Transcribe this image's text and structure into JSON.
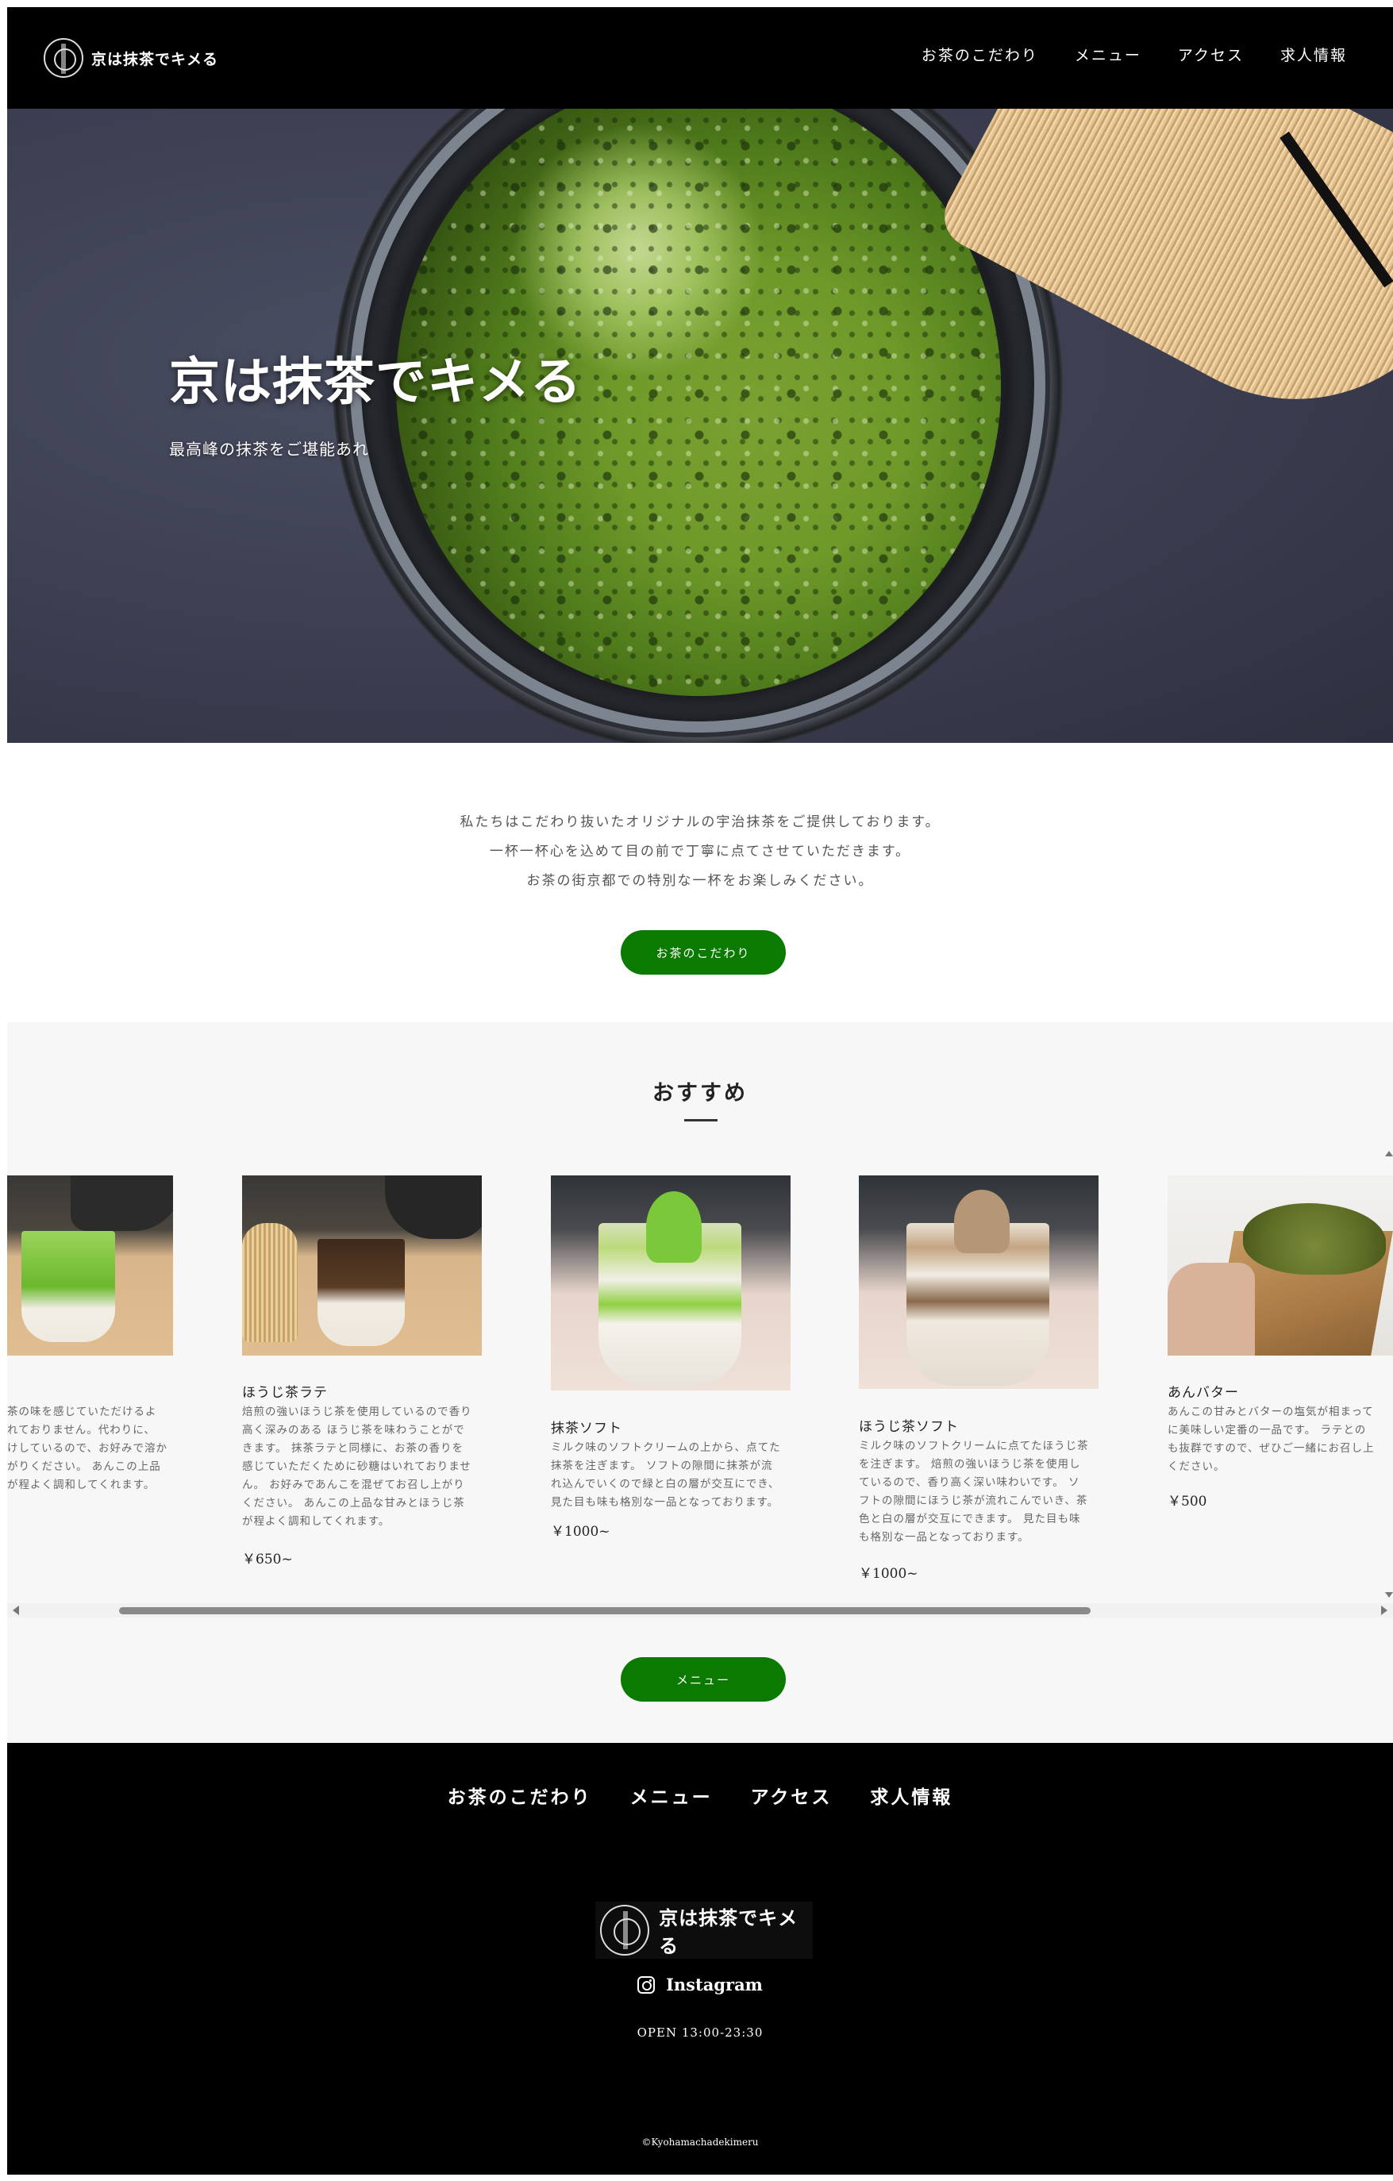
{
  "header": {
    "logo_text": "京は抹茶でキメる",
    "nav": [
      "お茶のこだわり",
      "メニュー",
      "アクセス",
      "求人情報"
    ]
  },
  "hero": {
    "title": "京は抹茶でキメる",
    "subtitle": "最高峰の抹茶をご堪能あれ"
  },
  "intro": {
    "lines": [
      "私たちはこだわり抜いたオリジナルの宇治抹茶をご提供しております。",
      "一杯一杯心を込めて目の前で丁寧に点てさせていただきます。",
      "お茶の街京都での特別な一杯をお楽しみください。"
    ],
    "button": "お茶のこだわり"
  },
  "recommend": {
    "title": "おすすめ",
    "items": [
      {
        "name": "",
        "desc": "茶の味を感じていただけるよ\nれておりません。代わりに、\nけしているので、お好みで溶か\nがりください。 あんこの上品\nが程よく調和してくれます。",
        "price": ""
      },
      {
        "name": "ほうじ茶ラテ",
        "desc": "焙煎の強いほうじ茶を使用しているので香り\n高く深みのある ほうじ茶を味わうことがで\nきます。 抹茶ラテと同様に、お茶の香りを\n感じていただくために砂糖はいれておりませ\nん。 お好みであんこを混ぜてお召し上がり\nください。 あんこの上品な甘みとほうじ茶\nが程よく調和してくれます。",
        "price": "￥650~"
      },
      {
        "name": "抹茶ソフト",
        "desc": "ミルク味のソフトクリームの上から、点てた\n抹茶を注ぎます。 ソフトの隙間に抹茶が流\nれ込んでいくので緑と白の層が交互にでき、\n見た目も味も格別な一品となっております。",
        "price": "￥1000~"
      },
      {
        "name": "ほうじ茶ソフト",
        "desc": "ミルク味のソフトクリームに点てたほうじ茶\nを注ぎます。 焙煎の強いほうじ茶を使用し\nているので、香り高く深い味わいです。 ソ\nフトの隙間にほうじ茶が流れこんでいき、茶\n色と白の層が交互にできます。 見た目も味\nも格別な一品となっております。",
        "price": "￥1000~"
      },
      {
        "name": "あんバター",
        "desc": "あんこの甘みとバターの塩気が相まって\nに美味しい定番の一品です。 ラテとの\nも抜群ですので、ぜひご一緒にお召し上\nください。",
        "price": "￥500"
      }
    ],
    "button": "メニュー"
  },
  "footer": {
    "nav": [
      "お茶のこだわり",
      "メニュー",
      "アクセス",
      "求人情報"
    ],
    "logo_text": "京は抹茶でキメる",
    "instagram": "Instagram",
    "hours": "OPEN 13:00-23:30",
    "copyright": "©Kyohamachadekimeru"
  },
  "colors": {
    "accent_green": "#0a7a00",
    "header_bg": "#000000",
    "section_bg": "#f7f7f7"
  },
  "icons": [
    "logo-emblem-icon",
    "instagram-icon",
    "scroll-left-icon",
    "scroll-right-icon"
  ]
}
